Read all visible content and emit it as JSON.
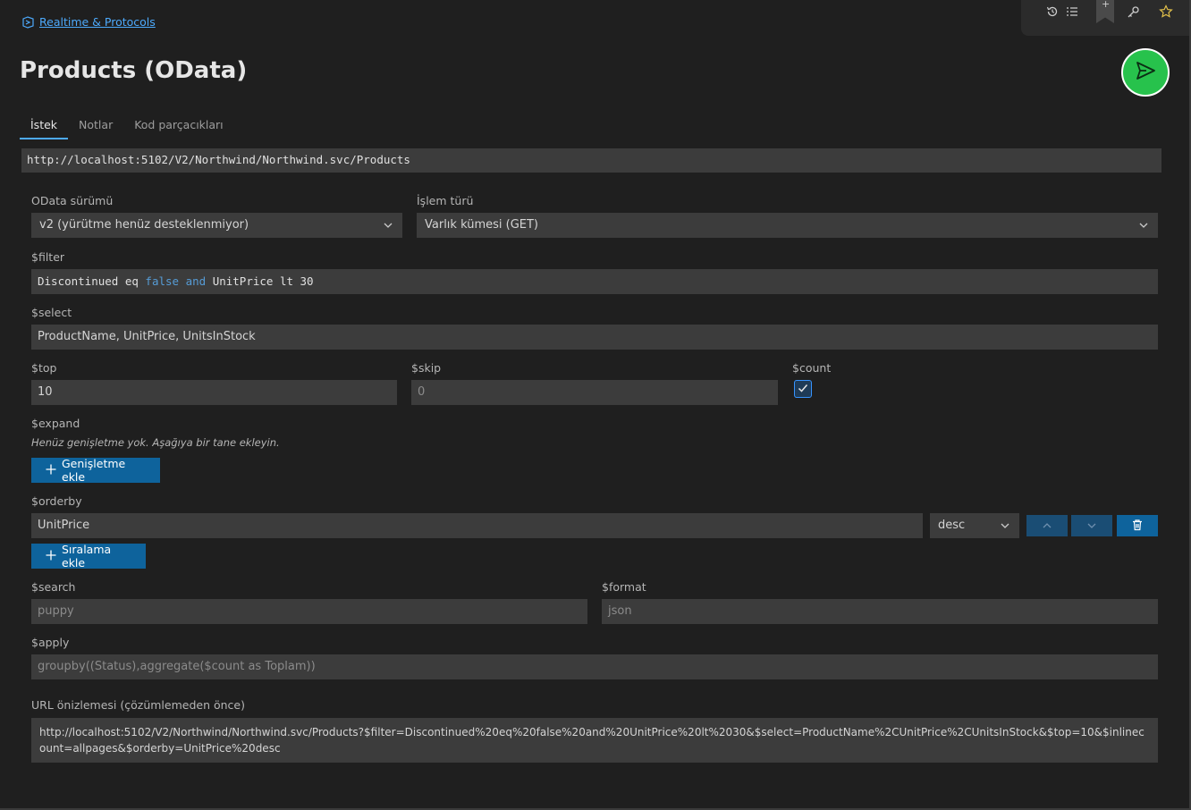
{
  "breadcrumb": {
    "label": "Realtime & Protocols"
  },
  "page": {
    "title": "Products (OData)"
  },
  "tabs": [
    {
      "label": "İstek",
      "active": true
    },
    {
      "label": "Notlar",
      "active": false
    },
    {
      "label": "Kod parçacıkları",
      "active": false
    }
  ],
  "request": {
    "url": "http://localhost:5102/V2/Northwind/Northwind.svc/Products"
  },
  "form": {
    "odata_version": {
      "label": "OData sürümü",
      "value": "v2 (yürütme henüz desteklenmiyor)"
    },
    "operation": {
      "label": "İşlem türü",
      "value": "Varlık kümesi (GET)"
    },
    "filter": {
      "label": "$filter",
      "tokens": {
        "t1": "Discontinued eq ",
        "t2": "false",
        "t3": " ",
        "t4": "and",
        "t5": " UnitPrice lt 30"
      }
    },
    "select": {
      "label": "$select",
      "value": "ProductName, UnitPrice, UnitsInStock"
    },
    "top": {
      "label": "$top",
      "value": "10"
    },
    "skip": {
      "label": "$skip",
      "placeholder": "0"
    },
    "count": {
      "label": "$count",
      "checked": true
    },
    "expand": {
      "label": "$expand",
      "hint": "Henüz genişletme yok. Aşağıya bir tane ekleyin.",
      "add_label": "Genişletme ekle"
    },
    "orderby": {
      "label": "$orderby",
      "field": "UnitPrice",
      "direction": "desc",
      "add_label": "Sıralama ekle"
    },
    "search": {
      "label": "$search",
      "placeholder": "puppy"
    },
    "format": {
      "label": "$format",
      "placeholder": "json"
    },
    "apply": {
      "label": "$apply",
      "placeholder": "groupby((Status),aggregate($count as Toplam))"
    }
  },
  "preview": {
    "label": "URL önizlemesi (çözümlemeden önce)",
    "url": "http://localhost:5102/V2/Northwind/Northwind.svc/Products?$filter=Discontinued%20eq%20false%20and%20UnitPrice%20lt%2030&$select=ProductName%2CUnitPrice%2CUnitsInStock&$top=10&$inlinecount=allpages&$orderby=UnitPrice%20desc"
  },
  "toolbar": {
    "icons": [
      "history-icon",
      "list-icon",
      "bookmark-icon",
      "key-icon",
      "star-icon"
    ],
    "bookmark_mark": "+"
  },
  "colors": {
    "accent": "#0e639c",
    "send": "#27c24c",
    "link": "#4daafc",
    "keyword": "#569cd6"
  }
}
